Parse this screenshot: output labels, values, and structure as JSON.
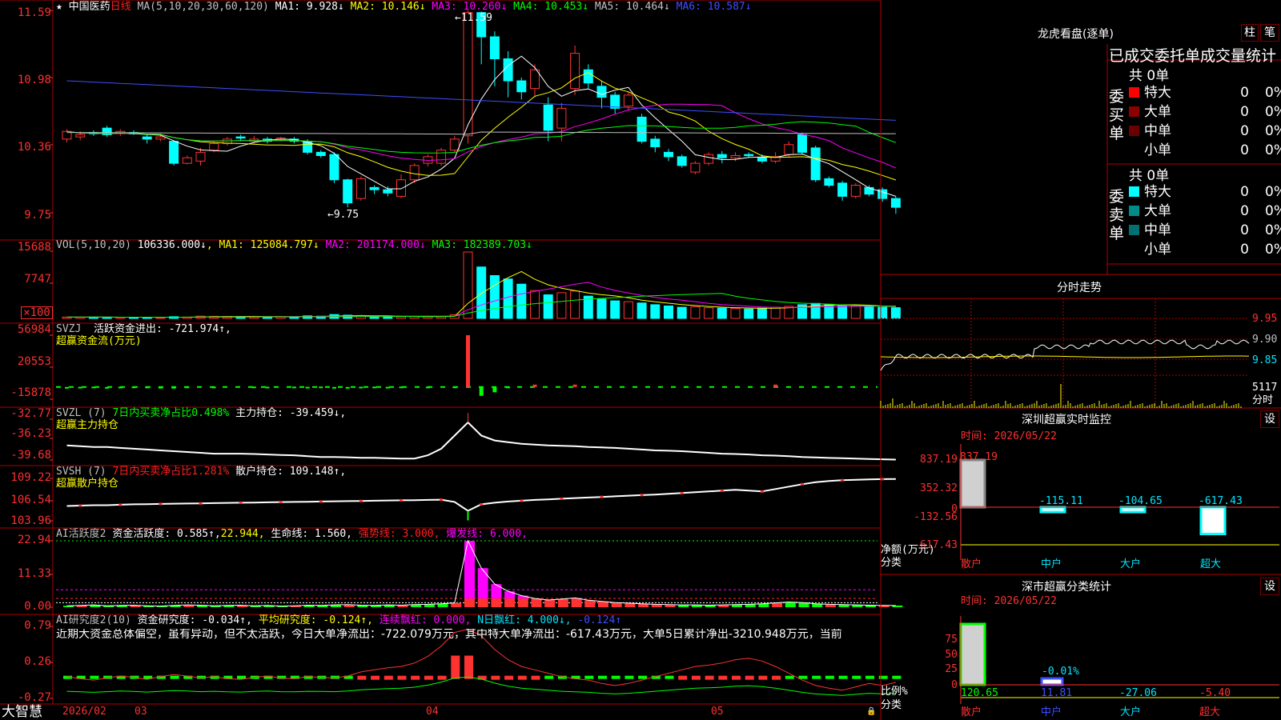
{
  "stock": {
    "name": "中国医药",
    "period": "日线",
    "ma_line": "MA(5,10,20,30,60,120)",
    "ma": [
      "MA1: 9.928↓",
      "MA2: 10.146↓",
      "MA3: 10.260↓",
      "MA4: 10.453↓",
      "MA5: 10.464↓",
      "MA6: 10.587↓"
    ],
    "high_mark": "11.59",
    "low_mark": "9.75"
  },
  "price_axis": [
    "11.59",
    "10.98",
    "10.36",
    "9.75"
  ],
  "vol": {
    "label": "VOL(5,10,20)",
    "value": "106336.000↓",
    "ma": [
      "MA1: 125084.797↓",
      "MA2: 201174.000↓",
      "MA3: 182389.703↓"
    ],
    "axis": [
      "15688",
      "7747"
    ],
    "unit": "×100"
  },
  "svzj": {
    "label": "SVZJ",
    "text": "活跃资金进出: -721.974↑,",
    "title": "超赢资金流(万元)",
    "axis": [
      "56984",
      "20553",
      "-15878"
    ]
  },
  "svzl": {
    "label": "SVZL (7)",
    "text1": "7日内买卖净占比0.498%",
    "text2": "主力持仓: -39.459↓,",
    "title": "超赢主力持仓",
    "axis": [
      "-32.77",
      "-36.23",
      "-39.68"
    ]
  },
  "svsh": {
    "label": "SVSH (7)",
    "text1": "7日内买卖净占比1.281%",
    "text2": "散户持仓: 109.148↑,",
    "title": "超赢散户持仓",
    "axis": [
      "109.22",
      "106.54",
      "103.96"
    ]
  },
  "ai": {
    "label": "AI活跃度2",
    "t1": "资金活跃度: 0.585↑,",
    "t2": "22.944,",
    "t3": "生命线: 1.560,",
    "t4": "强势线: 3.000,",
    "t5": "爆发线: 6.000,",
    "axis": [
      "22.94",
      "11.33",
      "0.00"
    ]
  },
  "research": {
    "label": "AI研究度2(10)",
    "t1": "资金研究度: -0.034↑,",
    "t2": "平均研究度: -0.124↑,",
    "t3": "连续飘红: 0.000,",
    "t4": "N日飘红: 4.000↓,",
    "t5": "-0.124↑",
    "commentary": "近期大资金总体偏空，虽有异动，但不太活跃，今日大单净流出：-722.079万元，其中特大单净流出：-617.43万元，大单5日累计净出-3210.948万元，当前",
    "axis": [
      "0.79",
      "0.26",
      "-0.27"
    ]
  },
  "date_axis": [
    "2026/02",
    "03",
    "04",
    "05"
  ],
  "brand": "大智慧",
  "dragon": {
    "title": "龙虎看盘(逐单)",
    "btn1": "柱",
    "btn2": "笔",
    "header": "已成交委托单成交量统计",
    "buy_label": "委买单",
    "sell_label": "委卖单",
    "buy_total": "共 0单",
    "sell_total": "共 0单",
    "buy_rows": [
      {
        "label": "特大",
        "count": "0",
        "pct": "0%",
        "color": "#ff0000"
      },
      {
        "label": "大单",
        "count": "0",
        "pct": "0%",
        "color": "#8b0000"
      },
      {
        "label": "中单",
        "count": "0",
        "pct": "0%",
        "color": "#6b0000"
      },
      {
        "label": "小单",
        "count": "0",
        "pct": "0%",
        "color": ""
      }
    ],
    "sell_rows": [
      {
        "label": "特大",
        "count": "0",
        "pct": "0%",
        "color": "#00ffff"
      },
      {
        "label": "大单",
        "count": "0",
        "pct": "0%",
        "color": "#008b8b"
      },
      {
        "label": "中单",
        "count": "0",
        "pct": "0%",
        "color": "#007070"
      },
      {
        "label": "小单",
        "count": "0",
        "pct": "0%",
        "color": ""
      }
    ]
  },
  "intraday": {
    "title": "分时走势",
    "axis": [
      "9.95",
      "9.90",
      "9.85"
    ],
    "vol_value": "5117",
    "vol_label": "分时"
  },
  "monitor": {
    "title": "深圳超赢实时监控",
    "btn": "设",
    "time": "时间: 2026/05/22",
    "axis": [
      "837.19",
      "352.32",
      "0",
      "-132.56",
      "-617.43"
    ],
    "ylabel": "净额(万元)",
    "xlabel": "分类",
    "categories": [
      "散户",
      "中户",
      "大户",
      "超大"
    ],
    "values": [
      "837.19",
      "-115.11",
      "-104.65",
      "-617.43"
    ]
  },
  "classify": {
    "title": "深市超赢分类统计",
    "btn": "设",
    "time": "时间: 2026/05/22",
    "axis": [
      "75",
      "50",
      "25",
      "0"
    ],
    "ylabel": "比例%",
    "xlabel": "分类",
    "categories": [
      "散户",
      "中户",
      "大户",
      "超大"
    ],
    "values": [
      "120.65",
      "11.81",
      "-27.06",
      "-5.40"
    ],
    "annotation": "-0.01%"
  },
  "chart_data": {
    "type": "bar",
    "candles": [
      [
        10.42,
        10.49,
        10.39,
        10.51
      ],
      [
        10.44,
        10.46,
        10.41,
        10.49
      ],
      [
        10.48,
        10.47,
        10.45,
        10.5
      ],
      [
        10.52,
        10.46,
        10.44,
        10.54
      ],
      [
        10.47,
        10.49,
        10.45,
        10.51
      ],
      [
        10.48,
        10.47,
        10.46,
        10.5
      ],
      [
        10.44,
        10.42,
        10.38,
        10.46
      ],
      [
        10.42,
        10.44,
        10.4,
        10.47
      ],
      [
        10.4,
        10.2,
        10.18,
        10.41
      ],
      [
        10.2,
        10.25,
        10.19,
        10.27
      ],
      [
        10.22,
        10.3,
        10.18,
        10.34
      ],
      [
        10.32,
        10.38,
        10.3,
        10.4
      ],
      [
        10.38,
        10.42,
        10.36,
        10.44
      ],
      [
        10.44,
        10.43,
        10.4,
        10.46
      ],
      [
        10.4,
        10.42,
        10.38,
        10.45
      ],
      [
        10.42,
        10.4,
        10.38,
        10.44
      ],
      [
        10.41,
        10.43,
        10.4,
        10.44
      ],
      [
        10.42,
        10.4,
        10.38,
        10.44
      ],
      [
        10.4,
        10.3,
        10.28,
        10.42
      ],
      [
        10.3,
        10.27,
        10.25,
        10.32
      ],
      [
        10.28,
        10.05,
        10.02,
        10.3
      ],
      [
        10.05,
        9.84,
        9.8,
        10.06
      ],
      [
        9.88,
        10.06,
        9.86,
        10.08
      ],
      [
        9.98,
        9.96,
        9.92,
        10.0
      ],
      [
        9.96,
        9.93,
        9.9,
        9.99
      ],
      [
        9.9,
        10.05,
        9.88,
        10.1
      ],
      [
        10.05,
        10.18,
        10.02,
        10.2
      ],
      [
        10.2,
        10.26,
        10.17,
        10.28
      ],
      [
        10.2,
        10.32,
        10.18,
        10.34
      ],
      [
        10.32,
        10.42,
        10.3,
        10.45
      ],
      [
        10.45,
        11.57,
        10.38,
        11.59
      ],
      [
        11.57,
        11.35,
        11.1,
        11.58
      ],
      [
        11.35,
        11.15,
        10.9,
        11.4
      ],
      [
        11.15,
        10.95,
        10.8,
        11.22
      ],
      [
        10.95,
        10.85,
        10.78,
        10.98
      ],
      [
        10.88,
        11.05,
        10.8,
        11.1
      ],
      [
        10.73,
        10.5,
        10.4,
        10.8
      ],
      [
        10.52,
        10.7,
        10.4,
        10.75
      ],
      [
        10.88,
        11.2,
        10.82,
        11.27
      ],
      [
        11.05,
        10.93,
        10.88,
        11.1
      ],
      [
        10.9,
        10.8,
        10.7,
        10.95
      ],
      [
        10.82,
        10.7,
        10.65,
        10.85
      ],
      [
        10.72,
        10.82,
        10.68,
        10.85
      ],
      [
        10.62,
        10.4,
        10.38,
        10.65
      ],
      [
        10.42,
        10.35,
        10.3,
        10.45
      ],
      [
        10.3,
        10.26,
        10.22,
        10.33
      ],
      [
        10.26,
        10.18,
        10.16,
        10.28
      ],
      [
        10.12,
        10.2,
        10.1,
        10.22
      ],
      [
        10.2,
        10.28,
        10.18,
        10.3
      ],
      [
        10.28,
        10.25,
        10.2,
        10.31
      ],
      [
        10.25,
        10.27,
        10.22,
        10.3
      ],
      [
        10.28,
        10.27,
        10.25,
        10.3
      ],
      [
        10.25,
        10.22,
        10.2,
        10.28
      ],
      [
        10.22,
        10.26,
        10.2,
        10.3
      ],
      [
        10.28,
        10.37,
        10.26,
        10.4
      ],
      [
        10.46,
        10.3,
        10.28,
        10.48
      ],
      [
        10.34,
        10.05,
        10.03,
        10.36
      ],
      [
        10.06,
        10.0,
        9.98,
        10.08
      ],
      [
        10.02,
        9.9,
        9.86,
        10.04
      ],
      [
        9.9,
        10.0,
        9.88,
        10.02
      ],
      [
        9.98,
        9.92,
        9.9,
        10.0
      ],
      [
        9.96,
        9.88,
        9.85,
        9.98
      ],
      [
        9.88,
        9.8,
        9.74,
        9.9
      ]
    ],
    "volume": [
      300,
      280,
      320,
      290,
      250,
      240,
      260,
      230,
      400,
      310,
      520,
      480,
      470,
      430,
      400,
      360,
      410,
      390,
      600,
      520,
      900,
      750,
      600,
      450,
      430,
      380,
      420,
      390,
      420,
      850,
      15500,
      12000,
      10000,
      9200,
      8000,
      6500,
      5500,
      6000,
      6400,
      5200,
      4500,
      4100,
      3900,
      3600,
      3200,
      2900,
      2600,
      2700,
      2500,
      2400,
      2300,
      2200,
      2400,
      2600,
      2800,
      3200,
      3500,
      3300,
      3000,
      2900,
      2700,
      2600,
      2500
    ],
    "svzj": [
      -2000,
      -1800,
      -1600,
      -2100,
      -1700,
      -1500,
      -1600,
      -1900,
      -2200,
      -1500,
      -1400,
      -1600,
      -1300,
      -1200,
      -1500,
      -1700,
      -1400,
      -1600,
      -1800,
      -1500,
      -2000,
      -2200,
      -1700,
      -1600,
      -1800,
      -1500,
      -1400,
      -1600,
      -1300,
      -1500,
      56984,
      -12000,
      -8000,
      -1500,
      -1200,
      400,
      -900,
      -700,
      800,
      -1100,
      -1000,
      -800,
      -900,
      -1200,
      -1000,
      -1100,
      -900,
      -1000,
      -800,
      -700,
      -900,
      -800,
      -600,
      800,
      -900,
      -1200,
      -1000,
      -900,
      -800,
      -700,
      -900,
      -800,
      -722
    ],
    "svzl": [
      -38.6,
      -38.65,
      -38.7,
      -38.7,
      -38.75,
      -38.8,
      -38.85,
      -38.9,
      -38.95,
      -39.0,
      -39.05,
      -39.1,
      -39.1,
      -39.1,
      -39.12,
      -39.15,
      -39.18,
      -39.2,
      -39.25,
      -39.3,
      -39.3,
      -39.32,
      -39.35,
      -39.35,
      -39.38,
      -39.4,
      -39.4,
      -39.2,
      -38.8,
      -38.0,
      -37.2,
      -38.0,
      -38.3,
      -38.4,
      -38.5,
      -38.55,
      -38.6,
      -38.62,
      -38.65,
      -38.7,
      -38.72,
      -38.75,
      -38.8,
      -38.85,
      -38.9,
      -38.92,
      -38.95,
      -39.0,
      -39.05,
      -39.1,
      -39.12,
      -39.15,
      -39.2,
      -39.22,
      -39.25,
      -39.3,
      -39.33,
      -39.36,
      -39.38,
      -39.4,
      -39.42,
      -39.44,
      -39.459
    ],
    "svsh": [
      105.8,
      105.85,
      105.9,
      105.9,
      105.95,
      106.0,
      106.02,
      106.05,
      106.08,
      106.1,
      106.12,
      106.15,
      106.18,
      106.2,
      106.22,
      106.25,
      106.28,
      106.3,
      106.32,
      106.35,
      106.38,
      106.4,
      106.42,
      106.45,
      106.48,
      106.5,
      106.52,
      106.55,
      106.58,
      106.3,
      105.2,
      106.0,
      106.2,
      106.35,
      106.45,
      106.55,
      106.62,
      106.7,
      106.78,
      106.85,
      106.92,
      107.0,
      107.08,
      107.15,
      107.22,
      107.3,
      107.4,
      107.5,
      107.6,
      107.7,
      107.8,
      107.7,
      107.6,
      107.9,
      108.2,
      108.5,
      108.75,
      108.9,
      109.0,
      109.05,
      109.1,
      109.13,
      109.148
    ],
    "ai": [
      0.5,
      0.6,
      0.8,
      0.5,
      0.6,
      0.7,
      0.5,
      0.4,
      0.6,
      0.8,
      0.7,
      0.5,
      0.6,
      0.7,
      0.5,
      0.6,
      0.4,
      0.5,
      0.7,
      0.6,
      0.8,
      0.9,
      0.7,
      0.6,
      0.8,
      0.7,
      0.9,
      1.0,
      1.2,
      1.5,
      22.94,
      13.5,
      8.0,
      5.5,
      4.0,
      3.0,
      2.5,
      2.8,
      3.2,
      2.4,
      2.0,
      1.6,
      1.4,
      1.2,
      1.0,
      0.9,
      0.8,
      0.8,
      0.7,
      0.8,
      0.9,
      1.0,
      1.2,
      1.5,
      1.8,
      1.6,
      1.2,
      1.0,
      0.9,
      0.8,
      0.7,
      0.6,
      0.585
    ],
    "research": [
      0.05,
      0.02,
      0.0,
      0.03,
      0.06,
      0.04,
      0.01,
      0.05,
      0.08,
      0.06,
      0.03,
      0.05,
      0.02,
      0.01,
      0.04,
      0.06,
      0.03,
      0.02,
      0.05,
      0.04,
      0.03,
      0.06,
      0.12,
      0.15,
      0.18,
      0.2,
      0.25,
      0.35,
      0.5,
      0.7,
      0.75,
      0.65,
      0.45,
      0.3,
      0.2,
      0.15,
      0.1,
      0.05,
      0.02,
      0.0,
      -0.05,
      -0.08,
      -0.05,
      0.0,
      0.05,
      0.1,
      0.15,
      0.2,
      0.22,
      0.25,
      0.3,
      0.32,
      0.28,
      0.2,
      0.1,
      0.0,
      -0.08,
      -0.12,
      -0.15,
      -0.1,
      -0.05,
      -0.08,
      -0.034
    ]
  }
}
